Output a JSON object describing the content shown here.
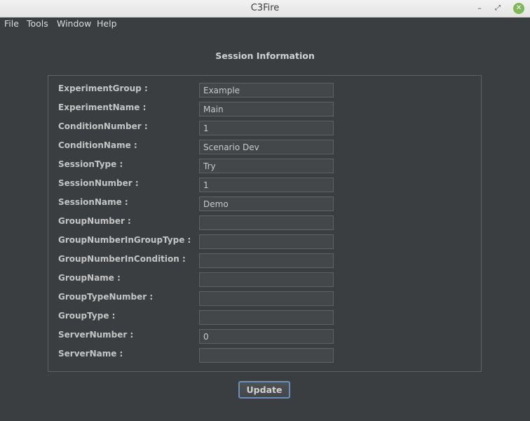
{
  "window": {
    "title": "C3Fire",
    "minimize_glyph": "–",
    "maximize_glyph": "⤢",
    "close_glyph": "✕"
  },
  "menu": [
    "File",
    "Tools",
    "Window",
    "Help"
  ],
  "heading": "Session Information",
  "fields": [
    {
      "label": "ExperimentGroup :",
      "value": "Example"
    },
    {
      "label": "ExperimentName :",
      "value": "Main"
    },
    {
      "label": "ConditionNumber :",
      "value": "1"
    },
    {
      "label": "ConditionName :",
      "value": "Scenario Dev"
    },
    {
      "label": "SessionType :",
      "value": "Try"
    },
    {
      "label": "SessionNumber :",
      "value": "1"
    },
    {
      "label": "SessionName :",
      "value": "Demo"
    },
    {
      "label": "GroupNumber :",
      "value": ""
    },
    {
      "label": "GroupNumberInGroupType :",
      "value": ""
    },
    {
      "label": "GroupNumberInCondition :",
      "value": ""
    },
    {
      "label": "GroupName :",
      "value": ""
    },
    {
      "label": "GroupTypeNumber :",
      "value": ""
    },
    {
      "label": "GroupType :",
      "value": ""
    },
    {
      "label": "ServerNumber :",
      "value": "0"
    },
    {
      "label": "ServerName :",
      "value": ""
    }
  ],
  "update_button": "Update",
  "colors": {
    "background": "#3b3e40",
    "field_bg": "#43474a",
    "button_focus": "#6b8fb6",
    "close_button": "#7fb85a"
  }
}
